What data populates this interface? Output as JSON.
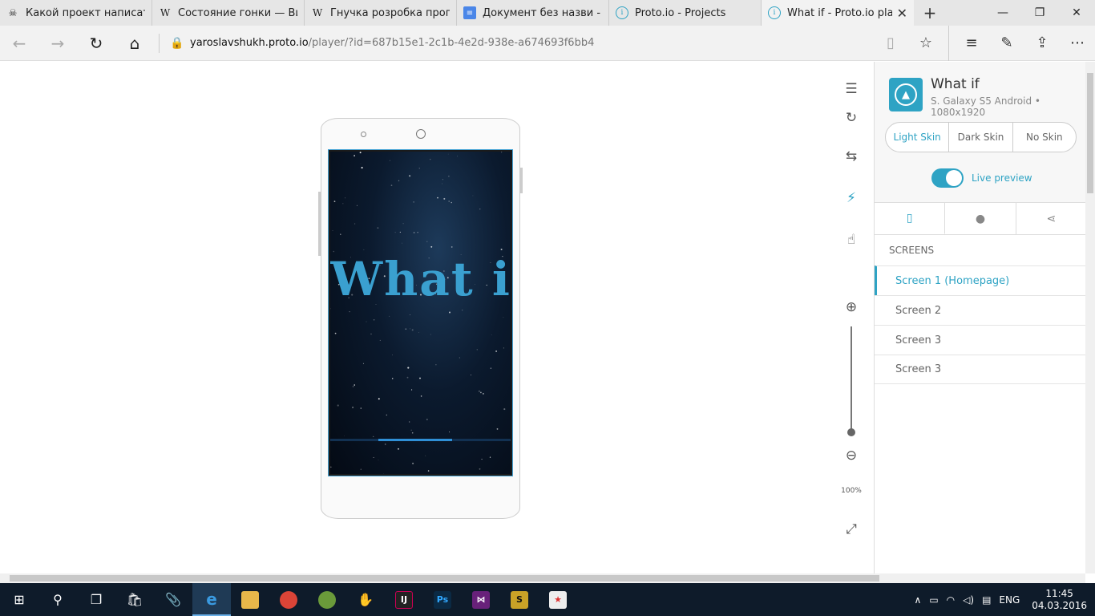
{
  "browser": {
    "tabs": [
      {
        "label": "Какой проект написать д",
        "icon": "pirate-icon"
      },
      {
        "label": "Состояние гонки — Вики",
        "icon": "wikipedia-icon"
      },
      {
        "label": "Гнучка розробка програм",
        "icon": "wikipedia-icon"
      },
      {
        "label": "Документ без назви - Go",
        "icon": "google-docs-icon"
      },
      {
        "label": "Proto.io - Projects",
        "icon": "protoio-icon"
      },
      {
        "label": "What if - Proto.io play",
        "icon": "protoio-icon",
        "active": true
      }
    ],
    "url_domain": "yaroslavshukh.proto.io",
    "url_path": "/player/?id=687b15e1-2c1b-4e2d-938e-a674693f6bb4"
  },
  "prototype": {
    "screen_title": "What if",
    "progress": 0.4
  },
  "tools": {
    "zoom_label": "100%"
  },
  "panel": {
    "app_title": "What if",
    "device": "S. Galaxy S5 Android • 1080x1920",
    "skins": [
      "Light Skin",
      "Dark Skin",
      "No Skin"
    ],
    "selected_skin": "Light Skin",
    "live_preview_label": "Live preview",
    "live_preview_on": true,
    "screens_heading": "SCREENS",
    "screens": [
      "Screen 1 (Homepage)",
      "Screen 2",
      "Screen 3",
      "Screen 3"
    ],
    "selected_screen": 0
  },
  "taskbar": {
    "lang": "ENG",
    "time": "11:45",
    "date": "04.03.2016"
  },
  "colors": {
    "accent": "#2ea3c4",
    "taskbar": "#0e1b2a"
  }
}
